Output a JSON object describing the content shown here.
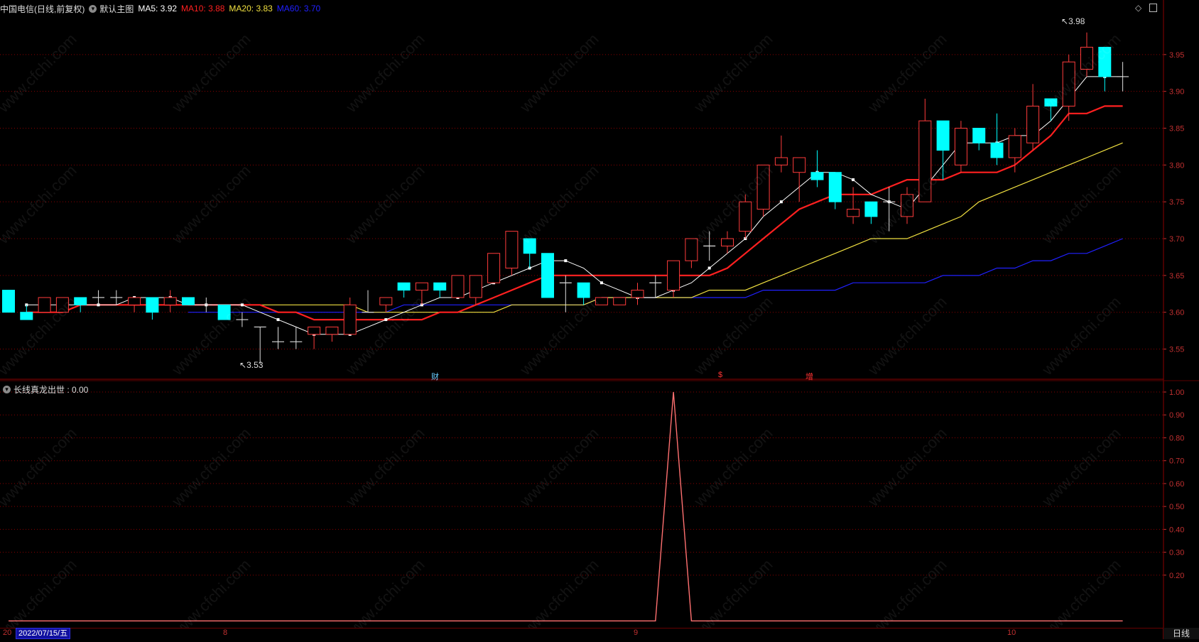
{
  "header": {
    "stock_title": "中国电信(日线,前复权)",
    "main_chart_label": "默认主图",
    "ma5": "MA5: 3.92",
    "ma10": "MA10: 3.88",
    "ma20": "MA20: 3.83",
    "ma60": "MA60: 3.70"
  },
  "indicator": {
    "label": "长线真龙出世 : 0.00"
  },
  "annotations": {
    "high": "3.98",
    "low": "3.53",
    "event_cai": "财",
    "event_s": "$",
    "event_zeng": "增"
  },
  "bottom": {
    "date": "2022/07/15/五",
    "date_prefix": "20",
    "month_8": "8",
    "month_9": "9",
    "month_10": "10",
    "period": "日线"
  },
  "watermark": "www.cfchi.com",
  "colors": {
    "up": "#ff3b3b",
    "down": "#00ffff",
    "ma5": "#ffffff",
    "ma10": "#ff2020",
    "ma20": "#f0e040",
    "ma60": "#2020ff",
    "grid": "#8a0000"
  },
  "chart_data": [
    {
      "type": "candlestick",
      "price_axis_ticks": [
        "3.95",
        "3.90",
        "3.85",
        "3.80",
        "3.75",
        "3.70",
        "3.65",
        "3.60",
        "3.55"
      ],
      "ylim": [
        3.51,
        4.0
      ],
      "ohlc": [
        [
          3.63,
          3.63,
          3.6,
          3.6
        ],
        [
          3.6,
          3.61,
          3.59,
          3.59
        ],
        [
          3.6,
          3.62,
          3.6,
          3.62
        ],
        [
          3.6,
          3.62,
          3.6,
          3.62
        ],
        [
          3.62,
          3.62,
          3.6,
          3.61
        ],
        [
          3.62,
          3.63,
          3.61,
          3.62
        ],
        [
          3.62,
          3.63,
          3.61,
          3.62
        ],
        [
          3.61,
          3.62,
          3.6,
          3.62
        ],
        [
          3.62,
          3.62,
          3.59,
          3.6
        ],
        [
          3.61,
          3.63,
          3.6,
          3.62
        ],
        [
          3.62,
          3.62,
          3.61,
          3.61
        ],
        [
          3.61,
          3.62,
          3.6,
          3.61
        ],
        [
          3.61,
          3.61,
          3.59,
          3.59
        ],
        [
          3.59,
          3.6,
          3.58,
          3.59
        ],
        [
          3.58,
          3.58,
          3.53,
          3.58
        ],
        [
          3.56,
          3.58,
          3.55,
          3.56
        ],
        [
          3.56,
          3.58,
          3.55,
          3.56
        ],
        [
          3.57,
          3.58,
          3.55,
          3.58
        ],
        [
          3.57,
          3.58,
          3.56,
          3.58
        ],
        [
          3.57,
          3.62,
          3.57,
          3.61
        ],
        [
          3.6,
          3.63,
          3.6,
          3.6
        ],
        [
          3.61,
          3.62,
          3.6,
          3.62
        ],
        [
          3.64,
          3.64,
          3.62,
          3.63
        ],
        [
          3.63,
          3.64,
          3.61,
          3.64
        ],
        [
          3.64,
          3.64,
          3.62,
          3.63
        ],
        [
          3.62,
          3.65,
          3.62,
          3.65
        ],
        [
          3.62,
          3.65,
          3.61,
          3.65
        ],
        [
          3.64,
          3.68,
          3.64,
          3.68
        ],
        [
          3.66,
          3.71,
          3.65,
          3.71
        ],
        [
          3.7,
          3.7,
          3.66,
          3.68
        ],
        [
          3.68,
          3.68,
          3.62,
          3.62
        ],
        [
          3.64,
          3.65,
          3.6,
          3.64
        ],
        [
          3.64,
          3.64,
          3.61,
          3.62
        ],
        [
          3.61,
          3.62,
          3.61,
          3.62
        ],
        [
          3.61,
          3.62,
          3.61,
          3.62
        ],
        [
          3.62,
          3.64,
          3.61,
          3.63
        ],
        [
          3.64,
          3.65,
          3.62,
          3.64
        ],
        [
          3.63,
          3.67,
          3.62,
          3.67
        ],
        [
          3.67,
          3.7,
          3.66,
          3.7
        ],
        [
          3.69,
          3.71,
          3.67,
          3.69
        ],
        [
          3.69,
          3.71,
          3.68,
          3.7
        ],
        [
          3.71,
          3.76,
          3.7,
          3.75
        ],
        [
          3.74,
          3.8,
          3.73,
          3.8
        ],
        [
          3.8,
          3.84,
          3.79,
          3.81
        ],
        [
          3.79,
          3.81,
          3.75,
          3.81
        ],
        [
          3.79,
          3.82,
          3.77,
          3.78
        ],
        [
          3.79,
          3.79,
          3.74,
          3.75
        ],
        [
          3.73,
          3.77,
          3.72,
          3.74
        ],
        [
          3.75,
          3.75,
          3.72,
          3.73
        ],
        [
          3.75,
          3.77,
          3.71,
          3.75
        ],
        [
          3.73,
          3.77,
          3.72,
          3.76
        ],
        [
          3.75,
          3.89,
          3.75,
          3.86
        ],
        [
          3.86,
          3.86,
          3.78,
          3.82
        ],
        [
          3.8,
          3.86,
          3.79,
          3.85
        ],
        [
          3.85,
          3.85,
          3.82,
          3.83
        ],
        [
          3.83,
          3.87,
          3.8,
          3.81
        ],
        [
          3.81,
          3.85,
          3.79,
          3.84
        ],
        [
          3.83,
          3.91,
          3.82,
          3.88
        ],
        [
          3.89,
          3.89,
          3.86,
          3.88
        ],
        [
          3.88,
          3.95,
          3.86,
          3.94
        ],
        [
          3.93,
          3.98,
          3.92,
          3.96
        ],
        [
          3.96,
          3.96,
          3.9,
          3.92
        ],
        [
          3.92,
          3.94,
          3.9,
          3.92
        ]
      ],
      "ma5": [
        3.61,
        3.61,
        3.61,
        3.61,
        3.61,
        3.61,
        3.62,
        3.62,
        3.62,
        3.61,
        3.61,
        3.61,
        3.61,
        3.6,
        3.59,
        3.58,
        3.57,
        3.57,
        3.57,
        3.58,
        3.59,
        3.6,
        3.61,
        3.62,
        3.62,
        3.63,
        3.64,
        3.65,
        3.66,
        3.67,
        3.67,
        3.66,
        3.64,
        3.63,
        3.62,
        3.62,
        3.63,
        3.64,
        3.66,
        3.68,
        3.7,
        3.73,
        3.75,
        3.77,
        3.79,
        3.79,
        3.78,
        3.76,
        3.75,
        3.74,
        3.77,
        3.8,
        3.83,
        3.83,
        3.83,
        3.84,
        3.84,
        3.86,
        3.89,
        3.92,
        3.92,
        3.92
      ],
      "ma10": [
        3.6,
        3.6,
        3.6,
        3.61,
        3.61,
        3.61,
        3.61,
        3.61,
        3.61,
        3.61,
        3.61,
        3.61,
        3.61,
        3.61,
        3.6,
        3.6,
        3.59,
        3.59,
        3.59,
        3.59,
        3.59,
        3.59,
        3.59,
        3.6,
        3.6,
        3.61,
        3.62,
        3.63,
        3.64,
        3.65,
        3.65,
        3.65,
        3.65,
        3.65,
        3.65,
        3.65,
        3.65,
        3.65,
        3.65,
        3.66,
        3.68,
        3.7,
        3.72,
        3.74,
        3.75,
        3.76,
        3.76,
        3.76,
        3.77,
        3.78,
        3.78,
        3.78,
        3.79,
        3.79,
        3.79,
        3.8,
        3.82,
        3.84,
        3.87,
        3.87,
        3.88,
        3.88
      ],
      "ma20": [
        3.61,
        3.61,
        3.61,
        3.61,
        3.61,
        3.61,
        3.61,
        3.61,
        3.61,
        3.61,
        3.61,
        3.61,
        3.61,
        3.61,
        3.61,
        3.6,
        3.6,
        3.6,
        3.6,
        3.6,
        3.6,
        3.6,
        3.6,
        3.61,
        3.61,
        3.61,
        3.61,
        3.61,
        3.62,
        3.62,
        3.62,
        3.62,
        3.62,
        3.62,
        3.63,
        3.63,
        3.63,
        3.64,
        3.65,
        3.66,
        3.67,
        3.68,
        3.69,
        3.7,
        3.7,
        3.7,
        3.71,
        3.72,
        3.73,
        3.75,
        3.76,
        3.77,
        3.78,
        3.79,
        3.8,
        3.81,
        3.82,
        3.83
      ],
      "ma60": [
        3.6,
        3.6,
        3.6,
        3.6,
        3.6,
        3.6,
        3.6,
        3.6,
        3.6,
        3.6,
        3.6,
        3.6,
        3.61,
        3.61,
        3.61,
        3.61,
        3.61,
        3.61,
        3.61,
        3.61,
        3.61,
        3.61,
        3.61,
        3.62,
        3.62,
        3.62,
        3.62,
        3.62,
        3.62,
        3.62,
        3.62,
        3.62,
        3.63,
        3.63,
        3.63,
        3.63,
        3.63,
        3.64,
        3.64,
        3.64,
        3.64,
        3.64,
        3.65,
        3.65,
        3.65,
        3.66,
        3.66,
        3.67,
        3.67,
        3.68,
        3.68,
        3.69,
        3.7
      ]
    },
    {
      "type": "line",
      "series": [
        {
          "name": "长线真龙出世",
          "values": [
            0,
            0,
            0,
            0,
            0,
            0,
            0,
            0,
            0,
            0,
            0,
            0,
            0,
            0,
            0,
            0,
            0,
            0,
            0,
            0,
            0,
            0,
            0,
            0,
            0,
            0,
            0,
            0,
            0,
            0,
            0,
            0,
            0,
            0,
            0,
            0,
            0,
            1,
            0,
            0,
            0,
            0,
            0,
            0,
            0,
            0,
            0,
            0,
            0,
            0,
            0,
            0,
            0,
            0,
            0,
            0,
            0,
            0,
            0,
            0,
            0,
            0,
            0
          ]
        }
      ],
      "indicator_axis_ticks": [
        "1.00",
        "0.90",
        "0.80",
        "0.70",
        "0.60",
        "0.50",
        "0.40",
        "0.30",
        "0.20"
      ],
      "ylim": [
        -0.03,
        1.0
      ]
    }
  ]
}
